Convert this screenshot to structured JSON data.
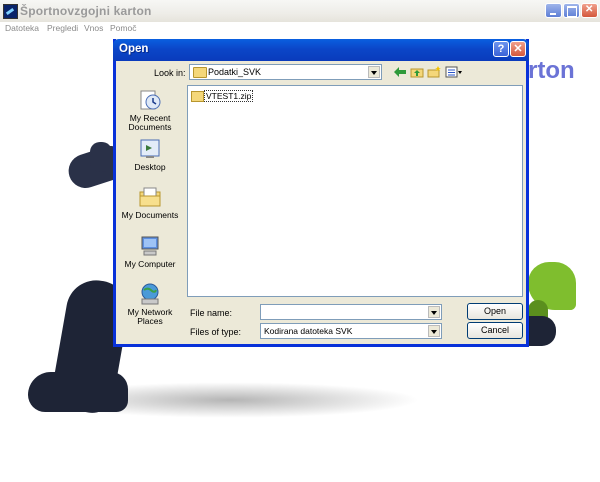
{
  "app": {
    "title": "Športnovzgojni karton",
    "brand_fragment": "rton"
  },
  "menu": [
    "Datoteka",
    "Pregledi",
    "Vnos",
    "Pomoč"
  ],
  "dialog": {
    "title": "Open",
    "look_in_label": "Look in:",
    "look_in_value": "Podatki_SVK",
    "places": [
      {
        "label": "My Recent Documents",
        "icon": "recent-documents-icon"
      },
      {
        "label": "Desktop",
        "icon": "desktop-icon"
      },
      {
        "label": "My Documents",
        "icon": "my-documents-icon"
      },
      {
        "label": "My Computer",
        "icon": "my-computer-icon"
      },
      {
        "label": "My Network Places",
        "icon": "network-places-icon"
      }
    ],
    "files": [
      "VTEST1.zip"
    ],
    "file_name_label": "File name:",
    "file_name_value": "",
    "files_of_type_label": "Files of type:",
    "files_of_type_value": "Kodirana datoteka SVK",
    "open_button": "Open",
    "cancel_button": "Cancel"
  },
  "colors": {
    "dialog_title": "#0a46c8",
    "dialog_body": "#ece9d8",
    "brand": "#6b73d6",
    "mascot_dark": "#1e2436",
    "mascot_green": "#7fbe2e"
  }
}
